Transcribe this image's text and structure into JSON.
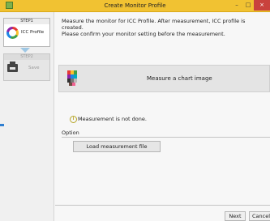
{
  "window": {
    "title": "Create Monitor Profile",
    "minimize_glyph": "–",
    "maximize_glyph": "□",
    "close_glyph": "×"
  },
  "steps": [
    {
      "header": "STEP1",
      "label": "ICC Profile",
      "icon": "color-ring-icon"
    },
    {
      "header": "STEP2",
      "label": "Save",
      "icon": "save-icon"
    }
  ],
  "main": {
    "intro_line1": "Measure the monitor for ICC Profile. After measurement, ICC profile is created.",
    "intro_line2": "Please confirm your monitor setting before the measurement.",
    "measure_button_label": "Measure a chart image",
    "status_text": "Measurement is not done.",
    "info_glyph": "i",
    "option_label": "Option",
    "load_button_label": "Load measurement file"
  },
  "footer": {
    "next_label": "Next",
    "cancel_label": "Cancel"
  },
  "colors": {
    "titlebar": "#f1c232",
    "close_button": "#c9423d",
    "accent_blue": "#2f7fd1"
  }
}
